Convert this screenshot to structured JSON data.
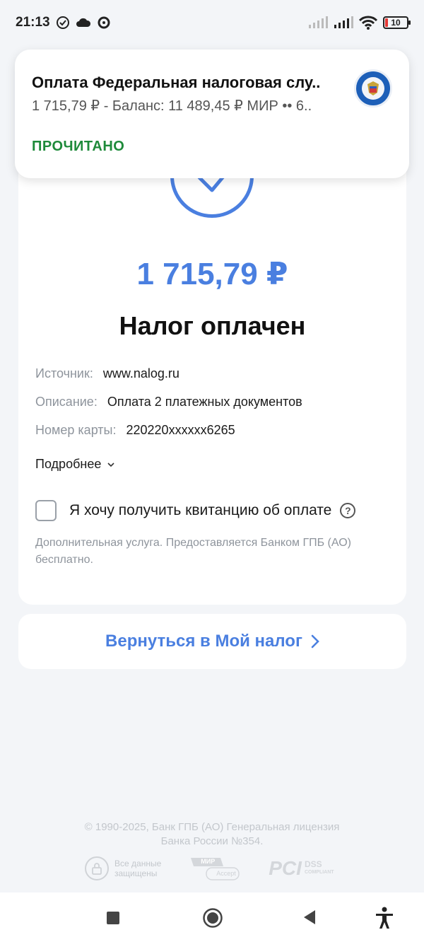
{
  "statusbar": {
    "time": "21:13",
    "battery": "10"
  },
  "notification": {
    "title": "Оплата Федеральная налоговая слу..",
    "body": "1 715,79 ₽ - Баланс: 11 489,45 ₽ МИР •• 6..",
    "action": "ПРОЧИТАНО"
  },
  "receipt": {
    "amount": "1 715,79 ₽",
    "status": "Налог оплачен",
    "details": [
      {
        "key": "Источник:",
        "value": "www.nalog.ru"
      },
      {
        "key": "Описание:",
        "value": "Оплата 2 платежных документов"
      },
      {
        "key": "Номер карты:",
        "value": "220220xxxxxx6265"
      }
    ],
    "more_label": "Подробнее",
    "checkbox_label": "Я хочу получить квитанцию об оплате",
    "note": "Дополнительная услуга. Предоставляется Банком ГПБ (АО) бесплатно."
  },
  "return_button": {
    "label": "Вернуться в Мой налог"
  },
  "footer": {
    "copyright_line1": "© 1990-2025, Банк ГПБ (АО) Генеральная лицензия",
    "copyright_line2": "Банка России №354.",
    "secure_line1": "Все данные",
    "secure_line2": "защищены",
    "mir_text": "МИР",
    "mir_sub": "Accept",
    "pci_text": "PCI",
    "dss_line1": "DSS",
    "dss_line2": "COMPLIANT"
  },
  "colors": {
    "accent": "#4a7fe0",
    "action_green": "#1e8a3a",
    "muted": "#8e949c",
    "background": "#f3f5f8"
  }
}
